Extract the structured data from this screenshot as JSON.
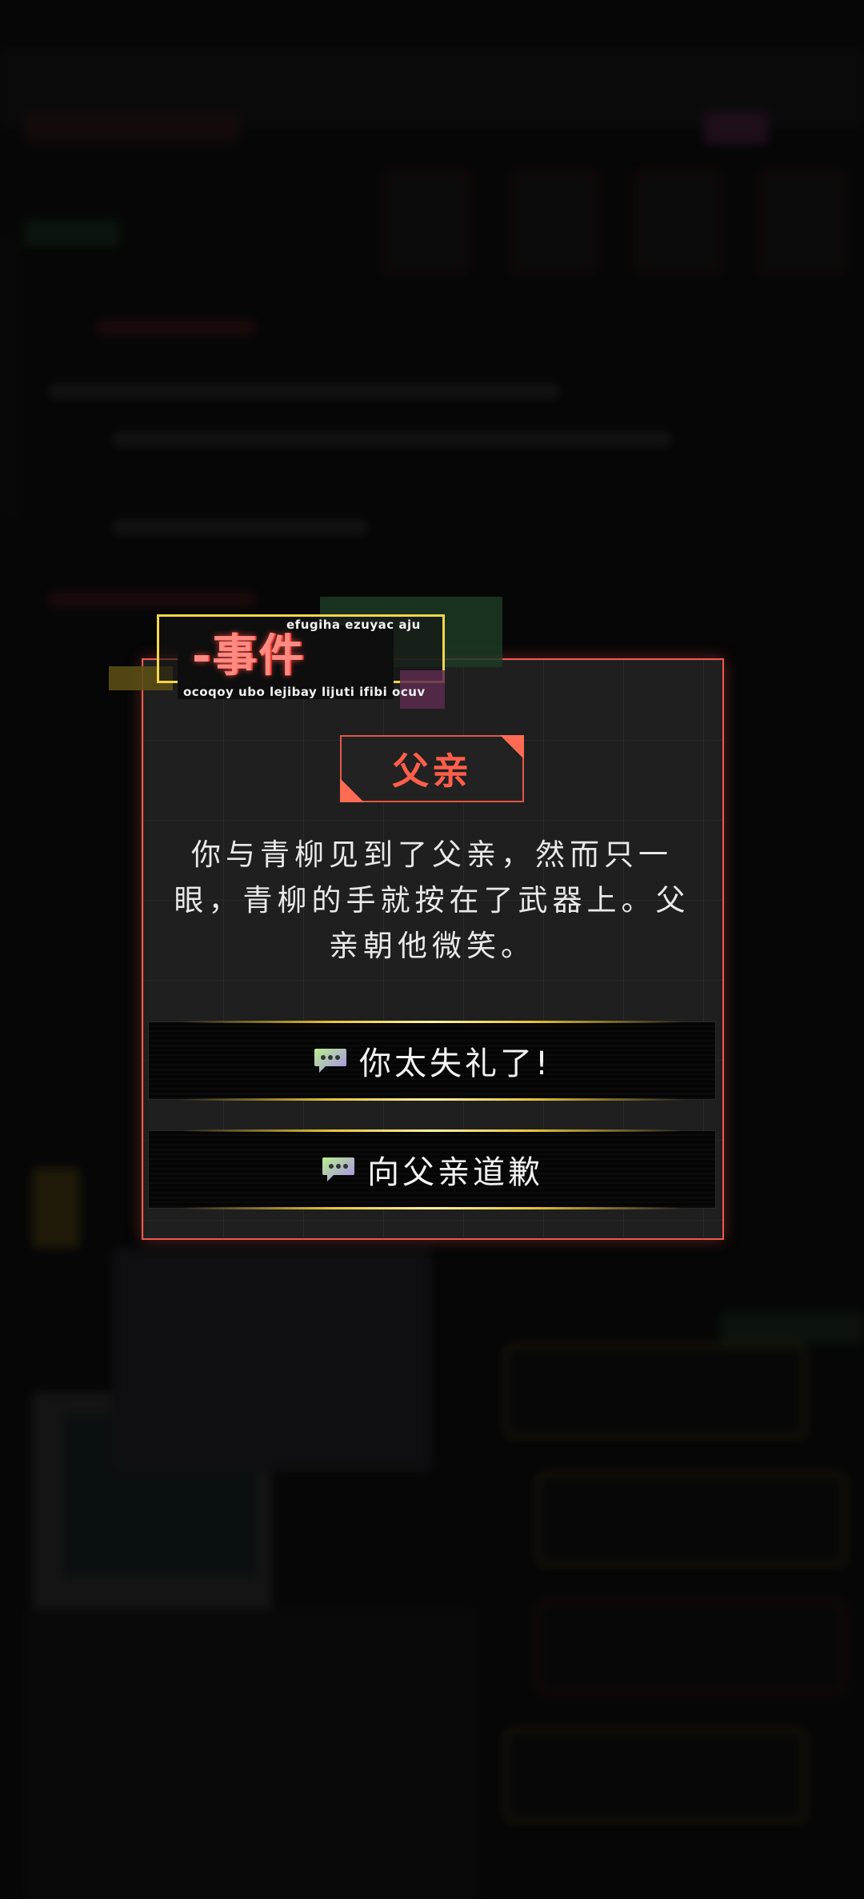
{
  "event_tag": {
    "title": "-事件",
    "sub_top": "efugiha ezuyac aju",
    "sub_bottom": "ocoqoy ubo lejibay lijuti ifibi ocuv"
  },
  "event": {
    "name": "父亲",
    "description": "你与青柳见到了父亲，然而只一眼，青柳的手就按在了武器上。父亲朝他微笑。"
  },
  "options": [
    {
      "label": "你太失礼了!",
      "icon": "chat-bubble-icon"
    },
    {
      "label": "向父亲道歉",
      "icon": "chat-bubble-icon"
    }
  ],
  "colors": {
    "accent_red": "#ef5a4c",
    "title_red": "#ff5f4a",
    "gold": "#e8c33a",
    "tag_yellow": "#f3d64b"
  }
}
